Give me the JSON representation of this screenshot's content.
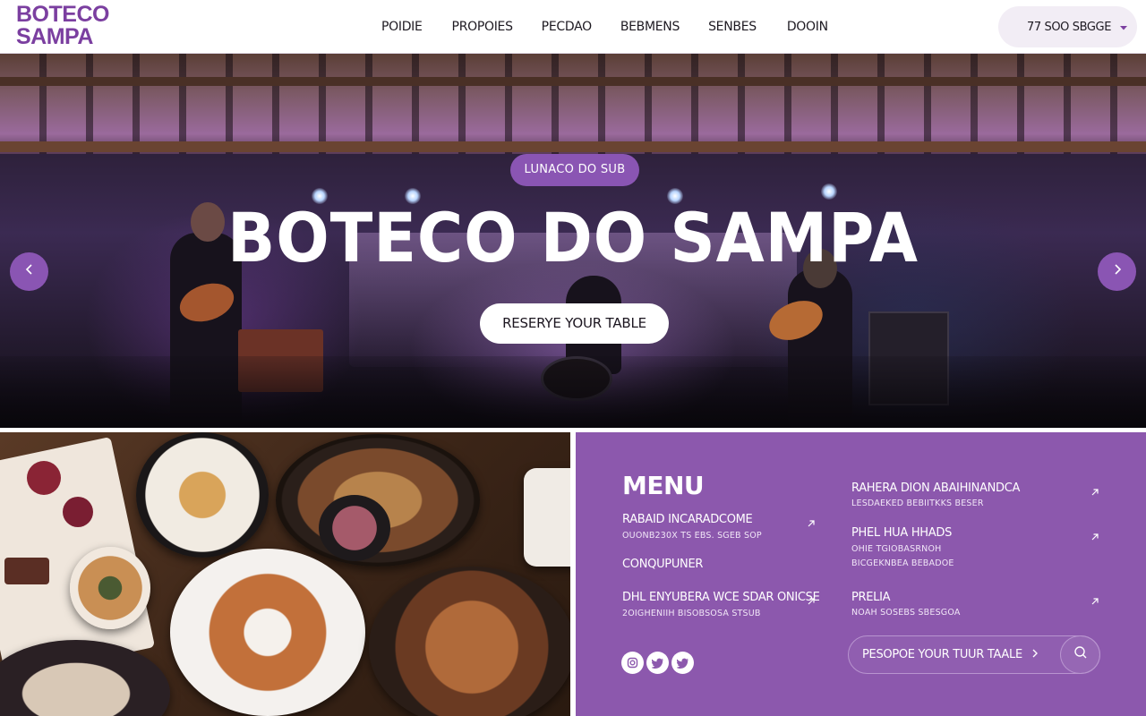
{
  "brand": {
    "logo_line1": "Boteco",
    "logo_line2": "Sampa",
    "accent": "#8a55b3",
    "logo_color": "#7b3fa0"
  },
  "nav": {
    "items": [
      "Poidie",
      "Propoies",
      "Pecdao",
      "Bebmens",
      "Senbes",
      "Dooin"
    ]
  },
  "location": {
    "value": "77 SOO SBGGE",
    "icon": "chevron-down-icon"
  },
  "hero": {
    "tagline": "lunaco do sub",
    "title": "Boteco do Sampa",
    "cta": "Reserye your table",
    "prev_icon": "chevron-left-icon",
    "next_icon": "chevron-right-icon"
  },
  "menu": {
    "title": "Menu",
    "left_items": [
      {
        "name": "Rabaid incaradcome",
        "desc": "ouonb230x ts ebs. sgeb sop"
      },
      {
        "name": "Conqupuner",
        "desc": ""
      },
      {
        "name": "Dhl enyubera wce sdar onicse",
        "desc": "2oigheniih bisobsosa stsub"
      }
    ],
    "right_items": [
      {
        "name": "Rahera dion abaihinandca",
        "desc": "lesdaeked bebiitkks beser"
      },
      {
        "name": "Phel hua hhads",
        "desc": "ohie tgiobasrnoh bicgeknbea bebadoe"
      },
      {
        "name": "Prelia",
        "desc": "noah sosebs sbesgoa"
      }
    ],
    "social": [
      "instagram-icon",
      "twitter-icon",
      "twitter-icon"
    ],
    "cta_label": "Pesopoe your tuur taale",
    "search_icon": "search-icon"
  }
}
